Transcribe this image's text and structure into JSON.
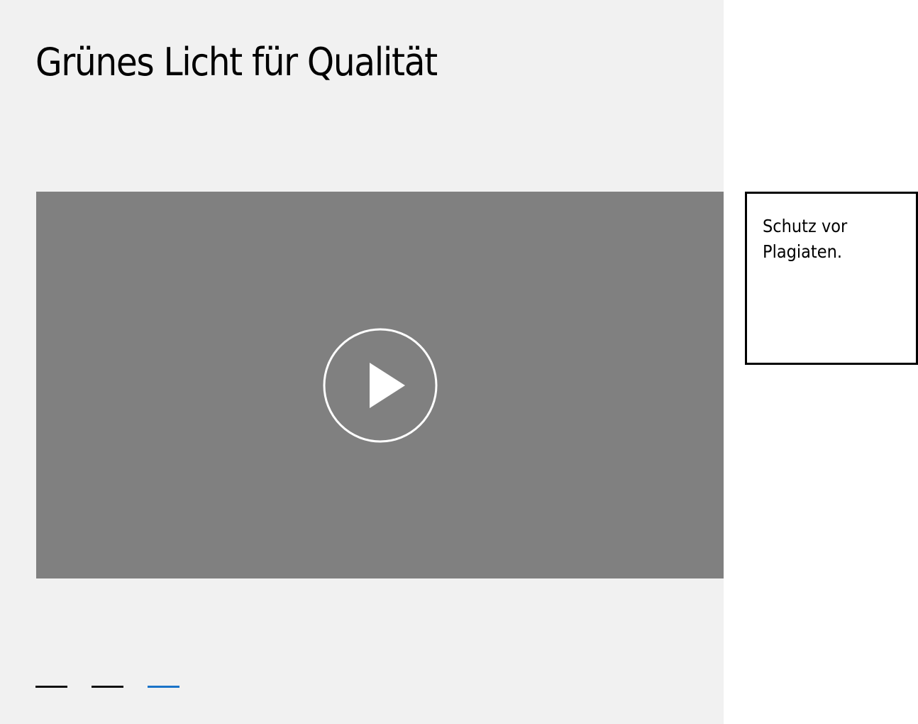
{
  "hero": {
    "title": "Grünes Licht für Qualität"
  },
  "video": {
    "play_icon": "play-circle-icon",
    "overlay_color": "#808080"
  },
  "pager": {
    "items": [
      {
        "active": false
      },
      {
        "active": false
      },
      {
        "active": true
      }
    ],
    "active_color": "#1a73c8"
  },
  "side_card": {
    "text": "Schutz vor Plagiaten."
  }
}
